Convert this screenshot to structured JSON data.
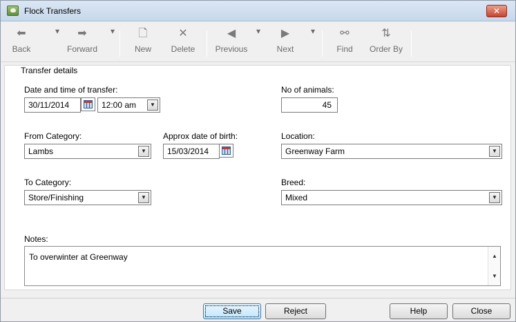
{
  "window": {
    "title": "Flock Transfers",
    "close_glyph": "✕"
  },
  "toolbar": {
    "back": "Back",
    "forward": "Forward",
    "new": "New",
    "delete": "Delete",
    "previous": "Previous",
    "next": "Next",
    "find": "Find",
    "order_by": "Order By"
  },
  "group": {
    "title": "Transfer details"
  },
  "form": {
    "date_time_label": "Date and time of transfer:",
    "date_value": "30/11/2014",
    "time_value": "12:00 am",
    "num_animals_label": "No of animals:",
    "num_animals_value": "45",
    "from_category_label": "From Category:",
    "from_category_value": "Lambs",
    "dob_label": "Approx date of birth:",
    "dob_value": "15/03/2014",
    "location_label": "Location:",
    "location_value": "Greenway Farm",
    "to_category_label": "To Category:",
    "to_category_value": "Store/Finishing",
    "breed_label": "Breed:",
    "breed_value": "Mixed",
    "notes_label": "Notes:",
    "notes_value": "To overwinter at Greenway"
  },
  "buttons": {
    "save": "Save",
    "reject": "Reject",
    "help": "Help",
    "close": "Close"
  },
  "icons": {
    "back": "arrow-left-icon",
    "forward": "arrow-right-icon",
    "new": "new-document-icon",
    "delete": "delete-x-icon",
    "previous": "triangle-left-icon",
    "next": "triangle-right-icon",
    "find": "binoculars-icon",
    "order_by": "sort-az-icon"
  }
}
